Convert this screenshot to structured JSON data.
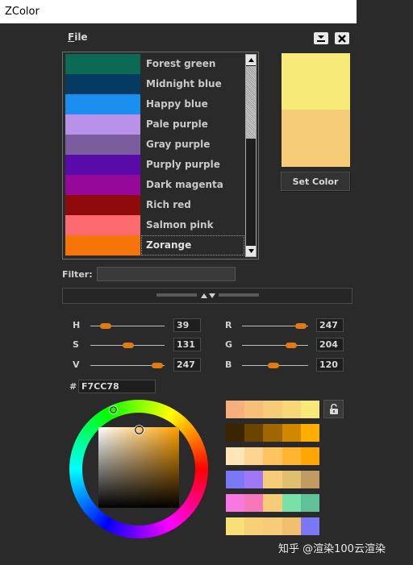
{
  "window": {
    "title": "ZColor"
  },
  "menu": {
    "file_label": "File",
    "file_mnemonic": "F",
    "file_rest": "ile"
  },
  "color_list": {
    "items": [
      {
        "label": "Forest green",
        "color": "#0b6a54"
      },
      {
        "label": "Midnight blue",
        "color": "#053a63"
      },
      {
        "label": "Happy blue",
        "color": "#1a8ff0"
      },
      {
        "label": "Pale purple",
        "color": "#b891e8"
      },
      {
        "label": "Gray purple",
        "color": "#7b5c9c"
      },
      {
        "label": "Purply purple",
        "color": "#5a0aa8"
      },
      {
        "label": "Dark magenta",
        "color": "#96089a"
      },
      {
        "label": "Rich red",
        "color": "#8f0a0a"
      },
      {
        "label": "Salmon pink",
        "color": "#fb6a6f"
      },
      {
        "label": "Zorange",
        "color": "#f67408"
      }
    ],
    "selected_index": 9
  },
  "preview": {
    "new_color": "#f7ea78",
    "current_color": "#f7cc78"
  },
  "set_color_label": "Set Color",
  "filter": {
    "label": "Filter:",
    "value": ""
  },
  "hsv": {
    "h": {
      "label": "H",
      "value": "39",
      "fraction": 0.15
    },
    "s": {
      "label": "S",
      "value": "131",
      "fraction": 0.51
    },
    "v": {
      "label": "V",
      "value": "247",
      "fraction": 0.97
    }
  },
  "rgb": {
    "r": {
      "label": "R",
      "value": "247",
      "fraction": 0.97
    },
    "g": {
      "label": "G",
      "value": "204",
      "fraction": 0.8
    },
    "b": {
      "label": "B",
      "value": "120",
      "fraction": 0.47
    }
  },
  "hex": {
    "hash": "#",
    "value": "F7CC78"
  },
  "picker": {
    "hue_color": "#ffa000"
  },
  "palette": {
    "rows": [
      [
        "#f7b07c",
        "#f7c078",
        "#f7cc78",
        "#f7d878",
        "#f7e878"
      ],
      [
        "#3a2500",
        "#6b4500",
        "#a06600",
        "#d08800",
        "#ffad00"
      ],
      [
        "#ffe6b8",
        "#ffd490",
        "#ffc460",
        "#ffb530",
        "#ffa600"
      ],
      [
        "#7b78f7",
        "#a078f7",
        "#f7cc78",
        "#e0c070",
        "#c09a60"
      ],
      [
        "#f778e0",
        "#f778b8",
        "#f7cc78",
        "#78e0a8",
        "#60c098"
      ],
      [
        "#f7e078",
        "#f7d078",
        "#f7cc78",
        "#f0c070",
        "#7b78f7"
      ]
    ]
  },
  "watermark": "知乎 @渲染100云渲染"
}
